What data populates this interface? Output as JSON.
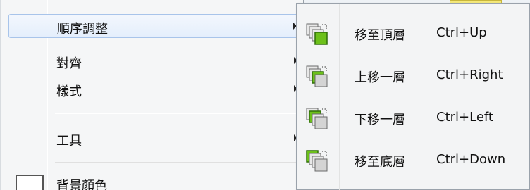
{
  "main_menu": {
    "items": [
      {
        "label": "順序調整",
        "has_submenu": true,
        "highlighted": true
      },
      {
        "label": "對齊",
        "has_submenu": true
      },
      {
        "label": "樣式",
        "has_submenu": true
      },
      {
        "label": "工具",
        "has_submenu": true
      },
      {
        "label": "背景顏色",
        "has_submenu": false
      }
    ]
  },
  "submenu": {
    "items": [
      {
        "label": "移至頂層",
        "shortcut": "Ctrl+Up",
        "icon": "bring-to-front-icon"
      },
      {
        "label": "上移一層",
        "shortcut": "Ctrl+Right",
        "icon": "bring-forward-icon"
      },
      {
        "label": "下移一層",
        "shortcut": "Ctrl+Left",
        "icon": "send-backward-icon"
      },
      {
        "label": "移至底層",
        "shortcut": "Ctrl+Down",
        "icon": "send-to-back-icon"
      }
    ]
  },
  "colors": {
    "highlight_border": "#a8c4ea",
    "icon_green": "#6cc01a",
    "icon_gray": "#d0d0d0"
  }
}
